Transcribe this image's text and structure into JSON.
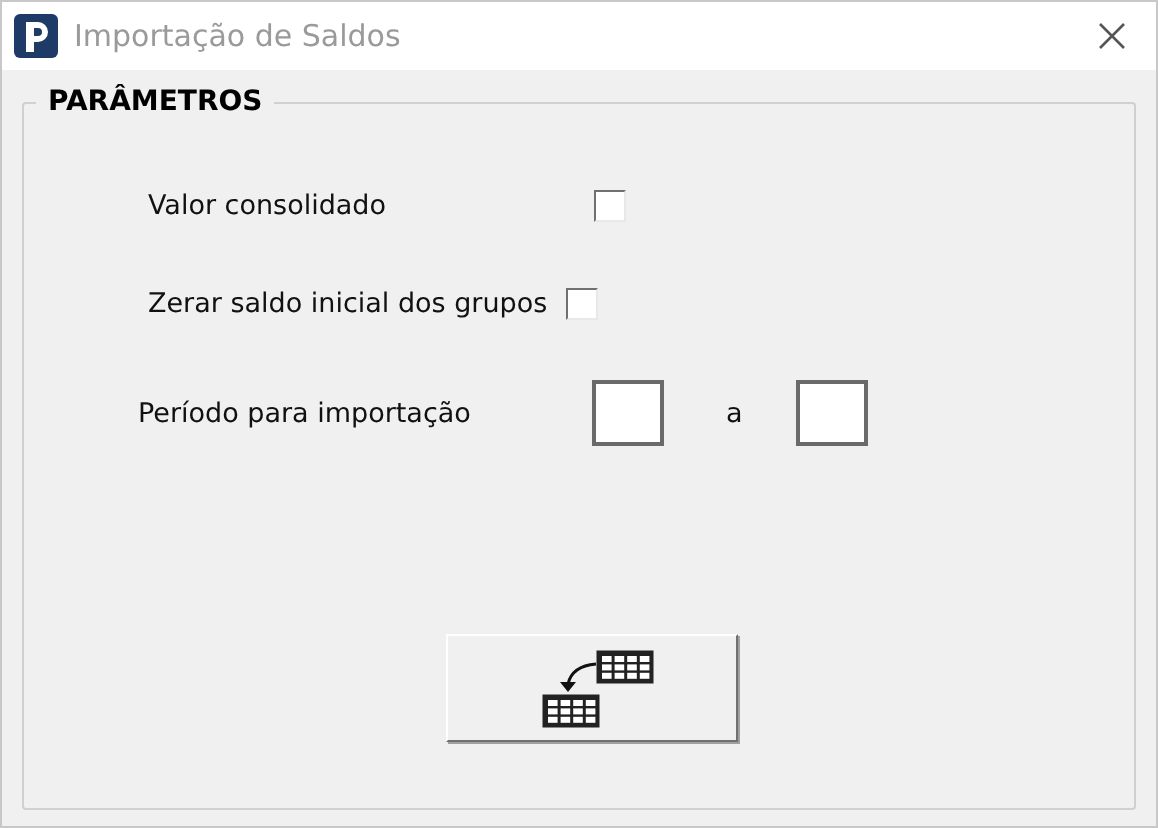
{
  "window": {
    "title": "Importação de Saldos"
  },
  "group": {
    "title": "PARÂMETROS"
  },
  "options": [
    {
      "label": "Valor consolidado",
      "checked": false
    },
    {
      "label": "Zerar saldo inicial dos grupos",
      "checked": false
    }
  ],
  "period": {
    "label": "Período para importação",
    "separator": "a"
  }
}
